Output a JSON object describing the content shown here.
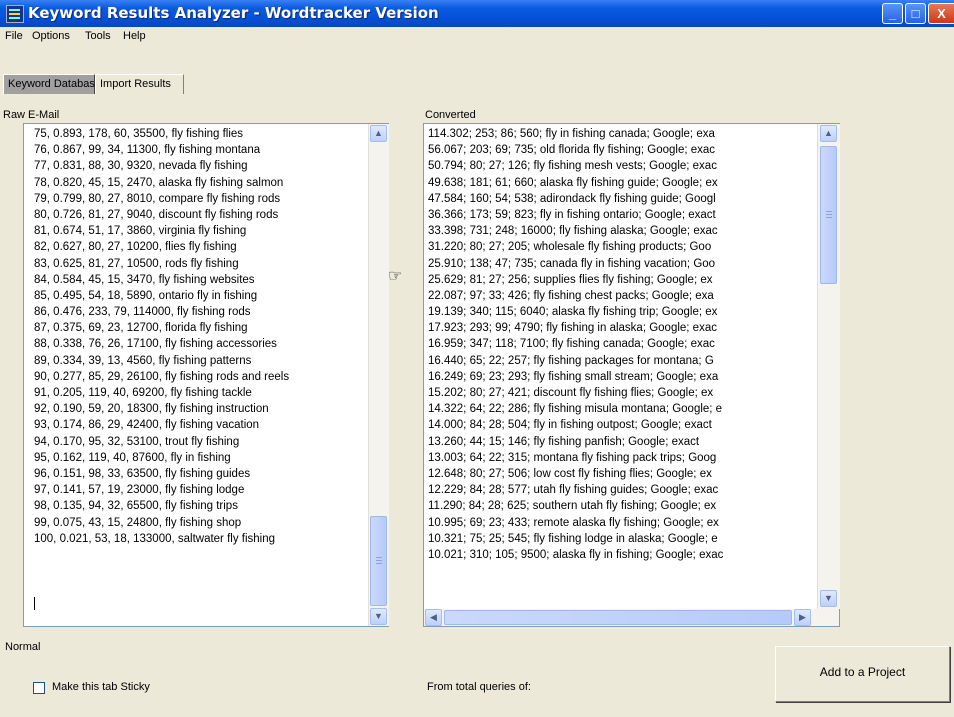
{
  "window": {
    "title": "Keyword Results Analyzer - Wordtracker Version",
    "controls": {
      "minimize": "_",
      "maximize": "□",
      "close": "X"
    }
  },
  "menu": [
    "File",
    "Options",
    "Tools",
    "Help"
  ],
  "tabs": [
    "Keyword Database",
    "Import Results"
  ],
  "raw_panel": {
    "label": "Raw E-Mail",
    "lines": [
      "75, 0.893, 178, 60, 35500, fly fishing flies",
      "76, 0.867, 99, 34, 11300, fly fishing montana",
      "77, 0.831, 88, 30, 9320, nevada fly fishing",
      "78, 0.820, 45, 15, 2470, alaska fly fishing salmon",
      "79, 0.799, 80, 27, 8010, compare fly fishing rods",
      "80, 0.726, 81, 27, 9040, discount fly fishing rods",
      "81, 0.674, 51, 17, 3860, virginia fly fishing",
      "82, 0.627, 80, 27, 10200, flies fly fishing",
      "83, 0.625, 81, 27, 10500, rods fly fishing",
      "84, 0.584, 45, 15, 3470, fly fishing websites",
      "85, 0.495, 54, 18, 5890, ontario fly in fishing",
      "86, 0.476, 233, 79, 114000, fly fishing rods",
      "87, 0.375, 69, 23, 12700, florida fly fishing",
      "88, 0.338, 76, 26, 17100, fly fishing accessories",
      "89, 0.334, 39, 13, 4560, fly fishing patterns",
      "90, 0.277, 85, 29, 26100, fly fishing rods and reels",
      "91, 0.205, 119, 40, 69200, fly fishing tackle",
      "92, 0.190, 59, 20, 18300, fly fishing instruction",
      "93, 0.174, 86, 29, 42400, fly fishing vacation",
      "94, 0.170, 95, 32, 53100, trout fly fishing",
      "95, 0.162, 119, 40, 87600, fly in fishing",
      "96, 0.151, 98, 33, 63500, fly fishing guides",
      "97, 0.141, 57, 19, 23000, fly fishing lodge",
      "98, 0.135, 94, 32, 65500, fly fishing trips",
      "99, 0.075, 43, 15, 24800, fly fishing shop",
      "100, 0.021, 53, 18, 133000, saltwater fly fishing"
    ]
  },
  "converted_panel": {
    "label": "Converted",
    "lines": [
      "114.302;   253;   86;   560;   fly in fishing canada; Google; exa",
      "56.067;   203;   69;   735;   old florida fly fishing; Google; exac",
      "50.794;   80;   27;   126;   fly fishing mesh vests; Google; exac",
      "49.638;   181;   61;   660;   alaska fly fishing guide; Google; ex",
      "47.584;   160;   54;   538;   adirondack fly fishing guide; Googl",
      "36.366;   173;   59;   823;   fly in fishing ontario; Google; exact",
      "33.398;   731;   248;   16000;   fly fishing alaska; Google; exac",
      "31.220;   80;   27;   205;   wholesale fly fishing products; Goo",
      "25.910;   138;   47;   735;   canada fly in fishing vacation; Goo",
      "25.629;   81;   27;   256;   supplies flies fly fishing; Google; ex",
      "22.087;   97;   33;   426;   fly fishing chest packs; Google; exa",
      "19.139;   340;   115;   6040;   alaska fly fishing trip; Google; ex",
      "17.923;   293;   99;   4790;   fly fishing in alaska; Google; exac",
      "16.959;   347;   118;   7100;   fly fishing canada; Google; exac",
      "16.440;   65;   22;   257;   fly fishing packages for montana; G",
      "16.249;   69;   23;   293;   fly fishing small stream; Google; exa",
      "15.202;   80;   27;   421;   discount fly fishing flies; Google; ex",
      "14.322;   64;   22;   286;   fly fishing misula montana; Google; e",
      "14.000;   84;   28;   504;   fly in fishing outpost; Google; exact",
      "13.260;   44;   15;   146;   fly fishing panfish; Google; exact",
      "13.003;   64;   22;   315;   montana fly fishing pack trips; Goog",
      "12.648;   80;   27;   506;   low cost fly fishing flies; Google; ex",
      "12.229;   84;   28;   577;   utah fly fishing guides; Google; exac",
      "11.290;   84;   28;   625;   southern utah fly fishing; Google; ex",
      "10.995;   69;   23;   433;   remote alaska fly fishing; Google; ex",
      "10.321;   75;   25;   545;   fly fishing lodge in alaska; Google; e",
      "10.021;   310;   105;   9500;   alaska fly in fishing; Google; exac"
    ]
  },
  "icons": {
    "arrow_pointer": "pointing-hand-icon",
    "scroll_up": "▲",
    "scroll_down": "▼",
    "scroll_left": "◀",
    "scroll_right": "▶"
  },
  "status": {
    "mode": "Normal"
  },
  "footer": {
    "sticky_checkbox_label": "Make this tab Sticky",
    "sticky_checked": false,
    "from_total_label": "From total queries of:",
    "add_button_label": "Add to a Project"
  },
  "colors": {
    "titlebar": "#0a5be0",
    "panel_border": "#7f9db9",
    "background": "#ece9d8"
  }
}
